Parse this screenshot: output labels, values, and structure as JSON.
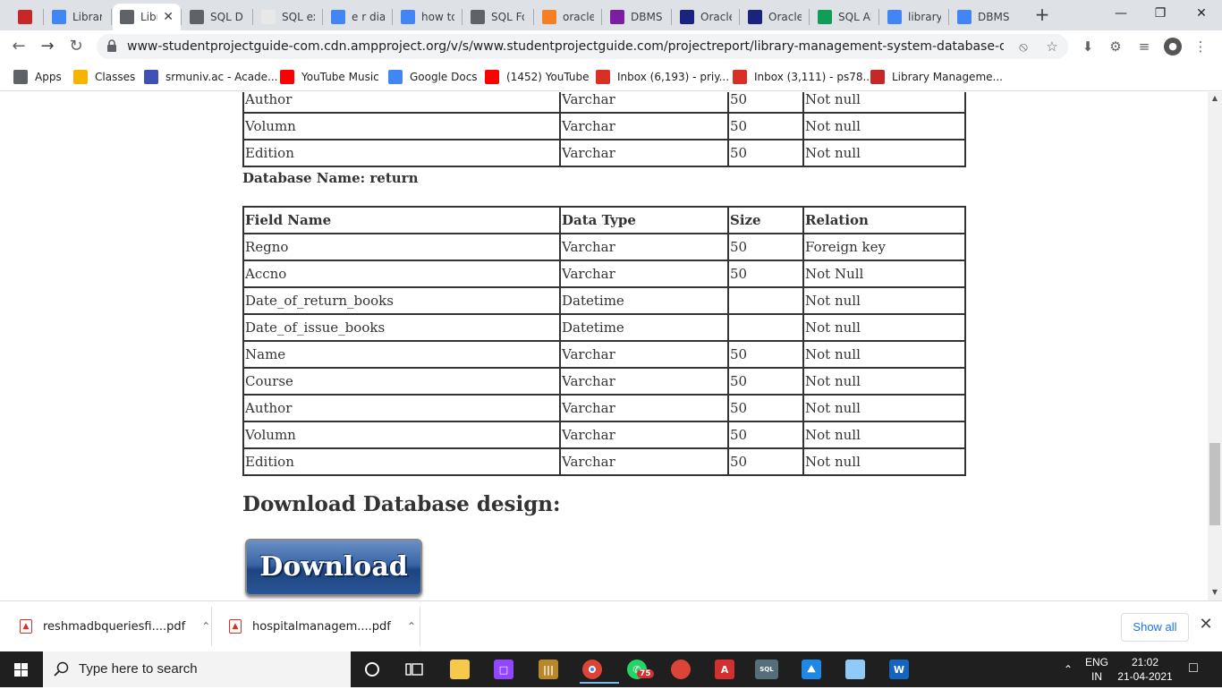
{
  "browser": {
    "tabs": [
      {
        "title": "",
        "favicon": "library-management-favicon",
        "color": "#c62828"
      },
      {
        "title": "Library",
        "favicon": "library-favicon",
        "color": "#4285f4"
      },
      {
        "title": "Libr",
        "favicon": "globe-favicon",
        "color": "#5f6368",
        "active": true
      },
      {
        "title": "SQL Da",
        "favicon": "globe-favicon",
        "color": "#5f6368"
      },
      {
        "title": "SQL ex",
        "favicon": "w3r-favicon",
        "color": "#e8e8e8"
      },
      {
        "title": "e r diag",
        "favicon": "google-favicon",
        "color": "#4285f4"
      },
      {
        "title": "how to",
        "favicon": "google-favicon",
        "color": "#4285f4"
      },
      {
        "title": "SQL Fo",
        "favicon": "home-favicon",
        "color": "#5f6368"
      },
      {
        "title": "oracle",
        "favicon": "stackoverflow-favicon",
        "color": "#f48024"
      },
      {
        "title": "DBMS",
        "favicon": "classroom-favicon",
        "color": "#7b1fa2"
      },
      {
        "title": "Oracle",
        "favicon": "t-favicon",
        "color": "#1a237e"
      },
      {
        "title": "Oracle",
        "favicon": "t-favicon",
        "color": "#1a237e"
      },
      {
        "title": "SQL AL",
        "favicon": "w-favicon",
        "color": "#0f9d58"
      },
      {
        "title": "library",
        "favicon": "google-favicon",
        "color": "#4285f4"
      },
      {
        "title": "DBMS",
        "favicon": "docs-favicon",
        "color": "#4285f4"
      }
    ],
    "url": "www-studentprojectguide-com.cdn.ampproject.org/v/s/www.studentprojectguide.com/projectreport/library-management-system-database-design/amp/?a...",
    "bookmarks": [
      {
        "label": "Apps",
        "icon": "apps-icon",
        "color": "#5f6368"
      },
      {
        "label": "Classes",
        "icon": "classroom-icon",
        "color": "#f4b400"
      },
      {
        "label": "srmuniv.ac - Acade...",
        "icon": "srm-icon",
        "color": "#3f51b5"
      },
      {
        "label": "YouTube Music",
        "icon": "youtube-music-icon",
        "color": "#ff0000"
      },
      {
        "label": "Google Docs",
        "icon": "docs-icon",
        "color": "#4285f4"
      },
      {
        "label": "(1452) YouTube",
        "icon": "youtube-icon",
        "color": "#ff0000"
      },
      {
        "label": "Inbox (6,193) - priy...",
        "icon": "gmail-icon",
        "color": "#d93025"
      },
      {
        "label": "Inbox (3,111) - ps78...",
        "icon": "gmail-icon",
        "color": "#d93025"
      },
      {
        "label": "Library Manageme...",
        "icon": "library-management-icon",
        "color": "#c62828"
      }
    ]
  },
  "page": {
    "top_table_rows": [
      [
        "Author",
        "Varchar",
        "50",
        "Not null"
      ],
      [
        "Volumn",
        "Varchar",
        "50",
        "Not null"
      ],
      [
        "Edition",
        "Varchar",
        "50",
        "Not null"
      ]
    ],
    "db_name_label": "Database Name: return",
    "return_table": {
      "headers": [
        "Field Name",
        "Data Type",
        "Size",
        "Relation"
      ],
      "rows": [
        [
          "Regno",
          "Varchar",
          "50",
          "Foreign key"
        ],
        [
          "Accno",
          "Varchar",
          "50",
          "Not Null"
        ],
        [
          "Date_of_return_books",
          "Datetime",
          "",
          "Not null"
        ],
        [
          "Date_of_issue_books",
          "Datetime",
          "",
          "Not null"
        ],
        [
          "Name",
          "Varchar",
          "50",
          "Not null"
        ],
        [
          "Course",
          "Varchar",
          "50",
          "Not null"
        ],
        [
          "Author",
          "Varchar",
          "50",
          "Not null"
        ],
        [
          "Volumn",
          "Varchar",
          "50",
          "Not null"
        ],
        [
          "Edition",
          "Varchar",
          "50",
          "Not null"
        ]
      ]
    },
    "download_heading": "Download Database design:",
    "download_button_label": "Download"
  },
  "downloads_bar": {
    "items": [
      {
        "name": "reshmadbqueriesfi....pdf"
      },
      {
        "name": "hospitalmanagem....pdf"
      }
    ],
    "show_all_label": "Show all"
  },
  "taskbar": {
    "search_placeholder": "Type here to search",
    "whatsapp_badge": "75",
    "language_line1": "ENG",
    "language_line2": "IN",
    "time": "21:02",
    "date": "21-04-2021"
  }
}
